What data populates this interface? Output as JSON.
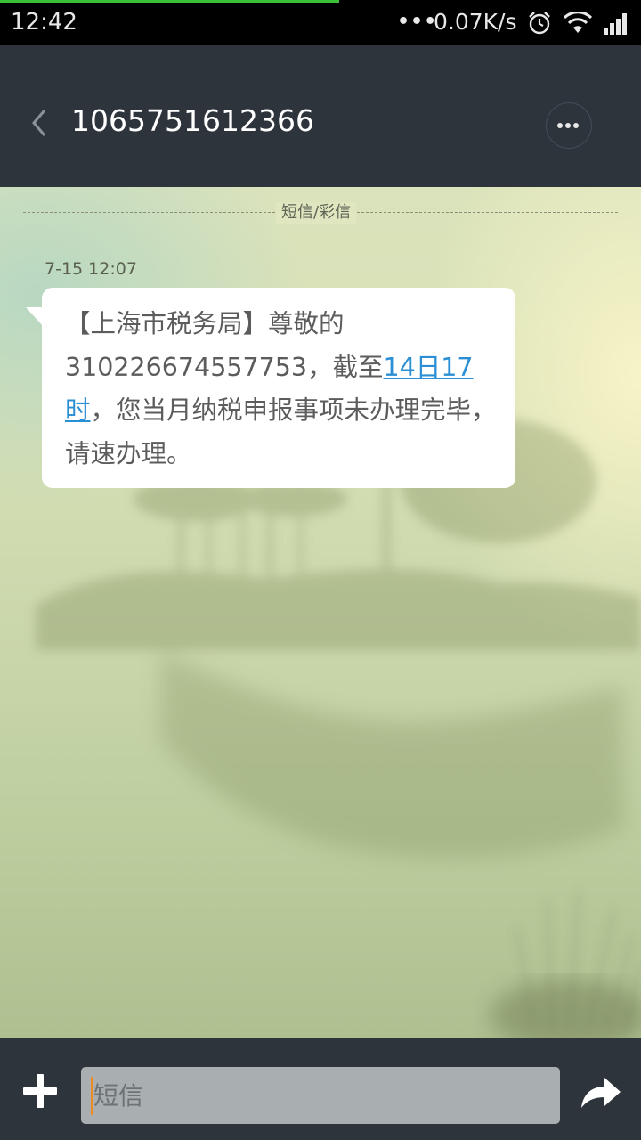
{
  "status_bar": {
    "time": "12:42",
    "dots": "•••",
    "net_speed": "0.07K/s",
    "icons": [
      "alarm-icon",
      "wifi-icon",
      "signal-icon"
    ]
  },
  "header": {
    "title": "1065751612366",
    "back_icon": "chevron-left-icon",
    "more_icon": "more-dots-icon"
  },
  "conversation": {
    "divider_label": "短信/彩信",
    "messages": [
      {
        "time": "7-15 12:07",
        "text_before_link": "【上海市税务局】尊敬的310226674557753，截至",
        "link_text": "14日17时",
        "text_after_link": "，您当月纳税申报事项未办理完毕，请速办理。"
      }
    ]
  },
  "composer": {
    "placeholder": "短信",
    "add_icon": "plus-icon",
    "send_icon": "send-arrow-icon"
  },
  "colors": {
    "status_bar_bg": "#000000",
    "header_bg": "#2e343c",
    "load_indicator": "#39c13a",
    "link": "#2a8fd4",
    "cursor": "#f08a24",
    "input_bg": "#a9aeb1"
  }
}
